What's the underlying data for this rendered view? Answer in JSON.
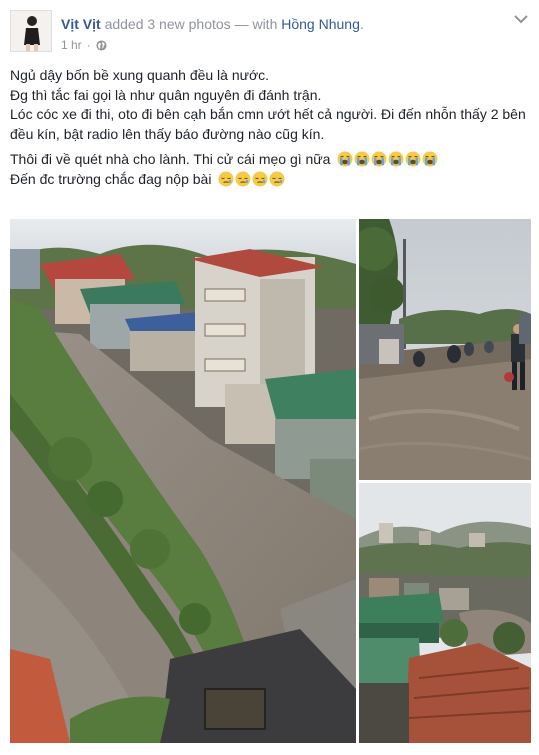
{
  "post": {
    "author": "Vịt Vịt",
    "action": "added 3 new photos",
    "with_prefix": "— with",
    "tagged": "Hồng Nhung",
    "period": ".",
    "time": "1 hr",
    "separator": "·",
    "paragraph1": [
      "Ngủ dậy bốn bề xung quanh đều là nước.",
      "Đg thì tắc fai gọi là như quân nguyên đi đánh trận.",
      "Lóc cóc xe đi thi, oto đi bên cạh bắn cmn ướt hết cả người. Đi đến nhỗn thấy 2 bên đều kín, bật radio lên thấy báo đường nào cũg kín."
    ],
    "paragraph2_line1": "Thôi đi về quét nhà cho lành. Thi cử cái mẹo gì nữa",
    "paragraph2_line2": "Đến đc trường chắc đag nộp bài",
    "emojis_line1": [
      "crying-face",
      "crying-face",
      "crying-face",
      "crying-face",
      "crying-face",
      "crying-face"
    ],
    "emojis_line2": [
      "sleepy-face",
      "sleepy-face",
      "sleepy-face",
      "sleepy-face"
    ]
  },
  "icons": {
    "header_menu": "chevron-down-icon",
    "privacy": "globe-icon"
  },
  "colors": {
    "link": "#365899",
    "text": "#1d2129",
    "meta": "#90949c",
    "flood_water": "#8a7f6f",
    "roof_red": "#b5473c",
    "roof_green": "#3f7f5a"
  },
  "photos": [
    {
      "description": "flooded-street-aerial"
    },
    {
      "description": "flooded-road-motorbikes"
    },
    {
      "description": "flooded-town-view"
    }
  ]
}
